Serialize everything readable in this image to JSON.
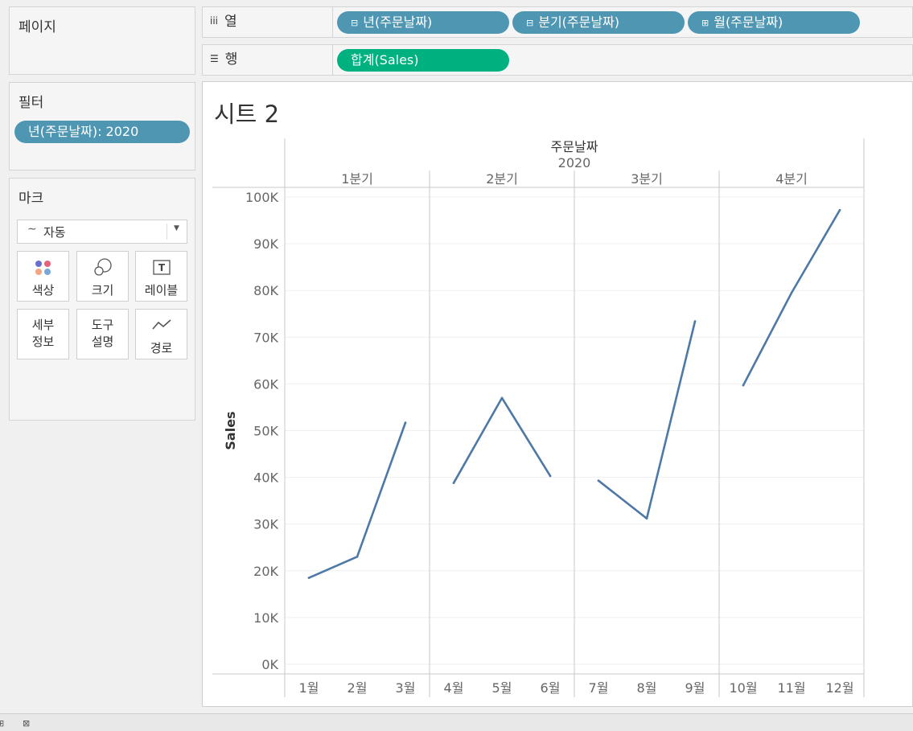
{
  "pages_panel": {
    "title": "페이지"
  },
  "filters_panel": {
    "title": "필터",
    "pills": [
      "년(주문날짜): 2020"
    ]
  },
  "marks_panel": {
    "title": "마크",
    "mark_type": "자동",
    "buttons": {
      "color": "색상",
      "size": "크기",
      "label": "레이블",
      "detail_line1": "세부",
      "detail_line2": "정보",
      "tooltip_line1": "도구",
      "tooltip_line2": "설명",
      "path": "경로"
    }
  },
  "columns_shelf": {
    "label": "열",
    "pills": [
      "년(주문날짜)",
      "분기(주문날짜)",
      "월(주문날짜)"
    ]
  },
  "rows_shelf": {
    "label": "행",
    "pills": [
      "합계(Sales)"
    ]
  },
  "sheet": {
    "title": "시트 2"
  },
  "colors": {
    "line": "#4e79a7",
    "pill_dim": "#4f96b2",
    "pill_measure": "#00b180"
  },
  "chart_data": {
    "type": "line",
    "header_title": "주문날짜",
    "header_year": "2020",
    "ylabel": "Sales",
    "ylim": [
      0,
      100000
    ],
    "y_ticks": [
      "0K",
      "10K",
      "20K",
      "30K",
      "40K",
      "50K",
      "60K",
      "70K",
      "80K",
      "90K",
      "100K"
    ],
    "panels": [
      {
        "quarter": "1분기",
        "months": [
          "1월",
          "2월",
          "3월"
        ],
        "values": [
          18500,
          23000,
          51700
        ]
      },
      {
        "quarter": "2분기",
        "months": [
          "4월",
          "5월",
          "6월"
        ],
        "values": [
          38800,
          57000,
          40300
        ]
      },
      {
        "quarter": "3분기",
        "months": [
          "7월",
          "8월",
          "9월"
        ],
        "values": [
          39300,
          31200,
          73400
        ]
      },
      {
        "quarter": "4분기",
        "months": [
          "10월",
          "11월",
          "12월"
        ],
        "values": [
          59700,
          79500,
          97200
        ]
      }
    ]
  }
}
